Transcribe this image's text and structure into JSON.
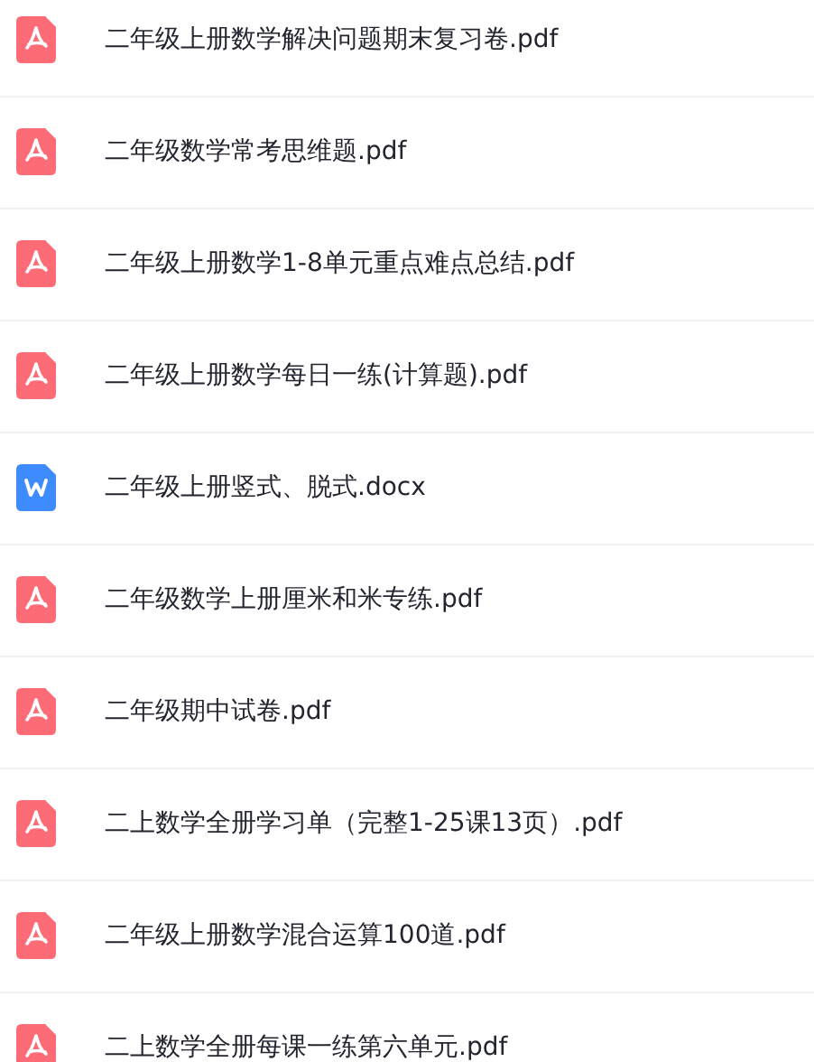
{
  "files": [
    {
      "kind": "pdf",
      "name": "二年级上册数学解决问题期末复习卷.pdf"
    },
    {
      "kind": "pdf",
      "name": "二年级数学常考思维题.pdf"
    },
    {
      "kind": "pdf",
      "name": "二年级上册数学1-8单元重点难点总结.pdf"
    },
    {
      "kind": "pdf",
      "name": "二年级上册数学每日一练(计算题).pdf"
    },
    {
      "kind": "word",
      "name": "二年级上册竖式、脱式.docx"
    },
    {
      "kind": "pdf",
      "name": "二年级数学上册厘米和米专练.pdf"
    },
    {
      "kind": "pdf",
      "name": "二年级期中试卷.pdf"
    },
    {
      "kind": "pdf",
      "name": "二上数学全册学习单（完整1-25课13页）.pdf"
    },
    {
      "kind": "pdf",
      "name": "二年级上册数学混合运算100道.pdf"
    },
    {
      "kind": "pdf",
      "name": "二上数学全册每课一练第六单元.pdf"
    }
  ]
}
